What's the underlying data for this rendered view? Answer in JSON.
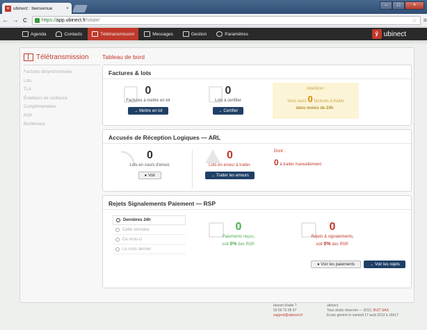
{
  "browser": {
    "tab_title": "ubinect : bienvenue",
    "tab_close": "×",
    "url_proto": "https://",
    "url_host": "app.ubinect.fr",
    "url_path": "/vitale/",
    "back": "←",
    "forward": "→",
    "reload": "C",
    "star": "☆",
    "menu": "≡"
  },
  "appnav": {
    "items": [
      {
        "label": "Agenda"
      },
      {
        "label": "Contacts"
      },
      {
        "label": "Télétransmission"
      },
      {
        "label": "Messages"
      },
      {
        "label": "Gestion"
      },
      {
        "label": "Paramètres"
      }
    ],
    "logo_text": "ubinect",
    "logo_mark": "ÿ"
  },
  "sidebar": {
    "title": "Télétransmission",
    "items": [
      {
        "label": "Factures désynchronisées"
      },
      {
        "label": "Lots"
      },
      {
        "label": "TLA"
      },
      {
        "label": "Émetteurs de confiance"
      },
      {
        "label": "Complémentaires"
      },
      {
        "label": "RSP"
      },
      {
        "label": "Bordereaux"
      }
    ]
  },
  "main": {
    "title": "Tableau de bord",
    "factures": {
      "heading": "Factures & lots",
      "left_count": "0",
      "left_caption": "Factures à mettre en lot",
      "left_button": "Mettre en lot",
      "mid_count": "0",
      "mid_caption": "Lots à certifier",
      "mid_button": "Certifier",
      "attention_title": "Attention !",
      "attention_pre": "Vous avez",
      "attention_count": "0",
      "attention_post": "factures à traiter",
      "attention_when": "dans moins de 24h",
      "attention_end": "."
    },
    "arl": {
      "heading": "Accusés de Réception Logiques — ARL",
      "left_count": "0",
      "left_caption": "Lots en cours d'envoi.",
      "left_button": "Voir",
      "mid_count": "0",
      "mid_caption": "Lots en erreur à traiter.",
      "mid_button": "Traiter les erreurs",
      "dont_label": "Dont :",
      "dont_count": "0",
      "dont_text": "à traiter manuellement"
    },
    "rsp": {
      "heading": "Rejets Signalements Paiement — RSP",
      "periods": [
        {
          "label": "Dernières 24h"
        },
        {
          "label": "Cette semaine"
        },
        {
          "label": "Ce mois-ci"
        },
        {
          "label": "Le mois dernier"
        }
      ],
      "pay_count": "0",
      "pay_caption": "Paiements reçus,",
      "pay_pre": "soit",
      "pay_pct": "0%",
      "pay_post": "des RSP.",
      "rej_count": "0",
      "rej_caption": "Rejets & signalements,",
      "rej_pre": "soit",
      "rej_pct": "0%",
      "rej_post": "des RSP.",
      "btn_pay": "Voir les paiements",
      "btn_rej": "Voir les rejets"
    }
  },
  "footer": {
    "help_title": "besoin d'aide ?",
    "help_phone": "03 66 72 05 97",
    "help_email": "support@ubinect.fr",
    "company": "ubinect",
    "rights": "Tous droits réservés — 2013,",
    "rights_link": "9h37 SAS",
    "generated": "Ecran généré le samedi 17 août 2013 à 16h17"
  },
  "colors": {
    "accent": "#c0392b",
    "navy": "#1f3f66",
    "green": "#4caf50",
    "warning_bg": "#fcf4d6"
  }
}
